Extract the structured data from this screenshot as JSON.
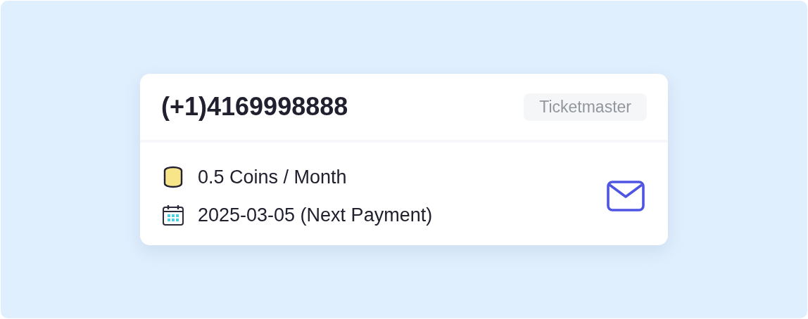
{
  "card": {
    "phone": "(+1)4169998888",
    "tag": "Ticketmaster",
    "details": [
      {
        "kind": "coins",
        "text": "0.5 Coins / Month"
      },
      {
        "kind": "calendar",
        "text": "2025-03-05 (Next Payment)"
      }
    ]
  }
}
